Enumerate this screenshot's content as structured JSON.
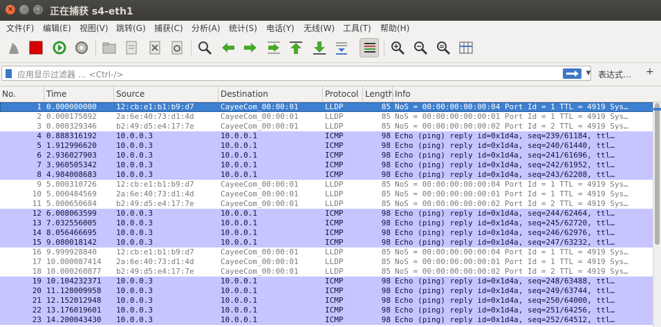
{
  "window": {
    "title": "正在捕获 s4-eth1",
    "close_glyph": "×",
    "min_glyph": "–",
    "max_glyph": "□"
  },
  "menu": [
    "文件(F)",
    "编辑(E)",
    "视图(V)",
    "跳转(G)",
    "捕获(C)",
    "分析(A)",
    "统计(S)",
    "电话(Y)",
    "无线(W)",
    "工具(T)",
    "帮助(H)"
  ],
  "toolbar": {
    "icons": [
      "shark-fin-start-icon",
      "stop-capture-icon",
      "restart-capture-icon",
      "capture-options-icon",
      "open-file-icon",
      "save-file-icon",
      "close-file-icon",
      "reload-file-icon",
      "find-packet-icon",
      "go-back-icon",
      "go-forward-icon",
      "go-to-packet-icon",
      "go-first-packet-icon",
      "go-last-packet-icon",
      "auto-scroll-icon",
      "colorize-icon",
      "zoom-in-icon",
      "zoom-out-icon",
      "normal-size-icon",
      "resize-columns-icon"
    ],
    "active": "colorize-icon",
    "colors": {
      "stop": "#d80000",
      "restart": "#2e9a2e",
      "nav_green": "#4aa82a"
    }
  },
  "filter": {
    "placeholder": "应用显示过滤器 … <Ctrl-/>",
    "expression_label": "表达式…",
    "plus_label": "+"
  },
  "columns": [
    "No.",
    "Time",
    "Source",
    "Destination",
    "Protocol",
    "Length",
    "Info"
  ],
  "colors": {
    "icmp_row": "#c7c5ff",
    "lldp_row": "#ffffff",
    "selected_row": "#3d7fd0"
  },
  "packets": [
    {
      "no": "1",
      "time": "0.000000000",
      "src": "12:cb:e1:b1:b9:d7",
      "dst": "CayeeCom_00:00:01",
      "proto": "LLDP",
      "len": "85",
      "info": "NoS = 00:00:00:00:00:04 Port Id = 1 TTL = 4919 Sys…",
      "type": "lldp",
      "selected": true
    },
    {
      "no": "2",
      "time": "0.000175892",
      "src": "2a:6e:40:73:d1:4d",
      "dst": "CayeeCom_00:00:01",
      "proto": "LLDP",
      "len": "85",
      "info": "NoS = 00:00:00:00:00:01 Port Id = 1 TTL = 4919 Sys…",
      "type": "lldp"
    },
    {
      "no": "3",
      "time": "0.000329346",
      "src": "b2:49:d5:e4:17:7e",
      "dst": "CayeeCom_00:00:01",
      "proto": "LLDP",
      "len": "85",
      "info": "NoS = 00:00:00:00:00:02 Port Id = 2 TTL = 4919 Sys…",
      "type": "lldp"
    },
    {
      "no": "4",
      "time": "0.888316192",
      "src": "10.0.0.3",
      "dst": "10.0.0.1",
      "proto": "ICMP",
      "len": "98",
      "info": "Echo (ping) reply    id=0x1d4a, seq=239/61184, ttl…",
      "type": "icmp"
    },
    {
      "no": "5",
      "time": "1.912996620",
      "src": "10.0.0.3",
      "dst": "10.0.0.1",
      "proto": "ICMP",
      "len": "98",
      "info": "Echo (ping) reply    id=0x1d4a, seq=240/61440, ttl…",
      "type": "icmp"
    },
    {
      "no": "6",
      "time": "2.936027903",
      "src": "10.0.0.3",
      "dst": "10.0.0.1",
      "proto": "ICMP",
      "len": "98",
      "info": "Echo (ping) reply    id=0x1d4a, seq=241/61696, ttl…",
      "type": "icmp"
    },
    {
      "no": "7",
      "time": "3.960505342",
      "src": "10.0.0.3",
      "dst": "10.0.0.1",
      "proto": "ICMP",
      "len": "98",
      "info": "Echo (ping) reply    id=0x1d4a, seq=242/61952, ttl…",
      "type": "icmp"
    },
    {
      "no": "8",
      "time": "4.984008683",
      "src": "10.0.0.3",
      "dst": "10.0.0.1",
      "proto": "ICMP",
      "len": "98",
      "info": "Echo (ping) reply    id=0x1d4a, seq=243/62208, ttl…",
      "type": "icmp"
    },
    {
      "no": "9",
      "time": "5.000310726",
      "src": "12:cb:e1:b1:b9:d7",
      "dst": "CayeeCom_00:00:01",
      "proto": "LLDP",
      "len": "85",
      "info": "NoS = 00:00:00:00:00:04 Port Id = 1 TTL = 4919 Sys…",
      "type": "lldp"
    },
    {
      "no": "10",
      "time": "5.000484569",
      "src": "2a:6e:40:73:d1:4d",
      "dst": "CayeeCom_00:00:01",
      "proto": "LLDP",
      "len": "85",
      "info": "NoS = 00:00:00:00:00:01 Port Id = 1 TTL = 4919 Sys…",
      "type": "lldp"
    },
    {
      "no": "11",
      "time": "5.000650684",
      "src": "b2:49:d5:e4:17:7e",
      "dst": "CayeeCom_00:00:01",
      "proto": "LLDP",
      "len": "85",
      "info": "NoS = 00:00:00:00:00:02 Port Id = 2 TTL = 4919 Sys…",
      "type": "lldp"
    },
    {
      "no": "12",
      "time": "6.008063599",
      "src": "10.0.0.3",
      "dst": "10.0.0.1",
      "proto": "ICMP",
      "len": "98",
      "info": "Echo (ping) reply    id=0x1d4a, seq=244/62464, ttl…",
      "type": "icmp"
    },
    {
      "no": "13",
      "time": "7.032556005",
      "src": "10.0.0.3",
      "dst": "10.0.0.1",
      "proto": "ICMP",
      "len": "98",
      "info": "Echo (ping) reply    id=0x1d4a, seq=245/62720, ttl…",
      "type": "icmp"
    },
    {
      "no": "14",
      "time": "8.056466695",
      "src": "10.0.0.3",
      "dst": "10.0.0.1",
      "proto": "ICMP",
      "len": "98",
      "info": "Echo (ping) reply    id=0x1d4a, seq=246/62976, ttl…",
      "type": "icmp"
    },
    {
      "no": "15",
      "time": "9.080018142",
      "src": "10.0.0.3",
      "dst": "10.0.0.1",
      "proto": "ICMP",
      "len": "98",
      "info": "Echo (ping) reply    id=0x1d4a, seq=247/63232, ttl…",
      "type": "icmp"
    },
    {
      "no": "16",
      "time": "9.999928840",
      "src": "12:cb:e1:b1:b9:d7",
      "dst": "CayeeCom_00:00:01",
      "proto": "LLDP",
      "len": "85",
      "info": "NoS = 00:00:00:00:00:04 Port Id = 1 TTL = 4919 Sys…",
      "type": "lldp"
    },
    {
      "no": "17",
      "time": "10.000087414",
      "src": "2a:6e:40:73:d1:4d",
      "dst": "CayeeCom_00:00:01",
      "proto": "LLDP",
      "len": "85",
      "info": "NoS = 00:00:00:00:00:01 Port Id = 1 TTL = 4919 Sys…",
      "type": "lldp"
    },
    {
      "no": "18",
      "time": "10.000260877",
      "src": "b2:49:d5:e4:17:7e",
      "dst": "CayeeCom_00:00:01",
      "proto": "LLDP",
      "len": "85",
      "info": "NoS = 00:00:00:00:00:02 Port Id = 2 TTL = 4919 Sys…",
      "type": "lldp"
    },
    {
      "no": "19",
      "time": "10.104232371",
      "src": "10.0.0.3",
      "dst": "10.0.0.1",
      "proto": "ICMP",
      "len": "98",
      "info": "Echo (ping) reply    id=0x1d4a, seq=248/63488, ttl…",
      "type": "icmp"
    },
    {
      "no": "20",
      "time": "11.128009958",
      "src": "10.0.0.3",
      "dst": "10.0.0.1",
      "proto": "ICMP",
      "len": "98",
      "info": "Echo (ping) reply    id=0x1d4a, seq=249/63744, ttl…",
      "type": "icmp"
    },
    {
      "no": "21",
      "time": "12.152012948",
      "src": "10.0.0.3",
      "dst": "10.0.0.1",
      "proto": "ICMP",
      "len": "98",
      "info": "Echo (ping) reply    id=0x1d4a, seq=250/64000, ttl…",
      "type": "icmp"
    },
    {
      "no": "22",
      "time": "13.176019601",
      "src": "10.0.0.3",
      "dst": "10.0.0.1",
      "proto": "ICMP",
      "len": "98",
      "info": "Echo (ping) reply    id=0x1d4a, seq=251/64256, ttl…",
      "type": "icmp"
    },
    {
      "no": "23",
      "time": "14.200043430",
      "src": "10.0.0.3",
      "dst": "10.0.0.1",
      "proto": "ICMP",
      "len": "98",
      "info": "Echo (ping) reply    id=0x1d4a, seq=252/64512, ttl…",
      "type": "icmp"
    }
  ]
}
